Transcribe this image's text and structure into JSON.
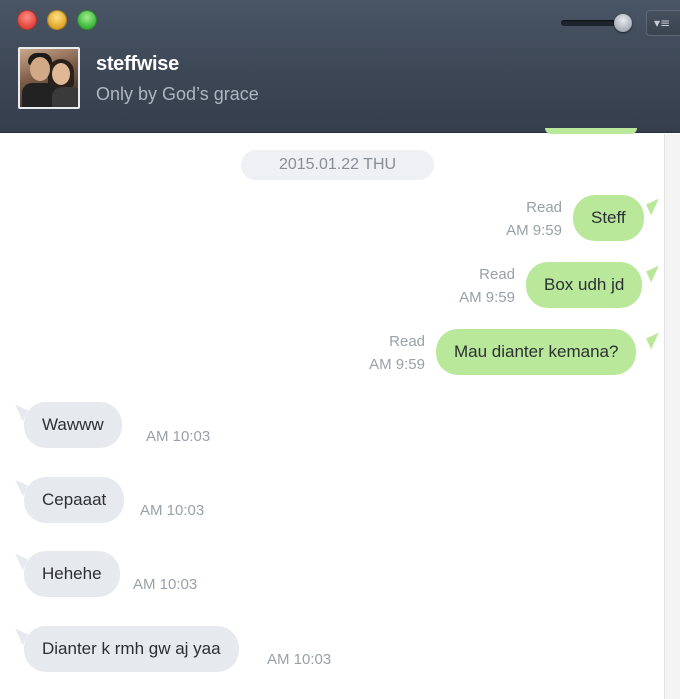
{
  "window": {
    "controls": [
      "close",
      "minimize",
      "maximize"
    ],
    "menu_button_glyph": "▾≡"
  },
  "header": {
    "contact_name": "steffwise",
    "contact_status": "Only by God’s grace"
  },
  "chat": {
    "date_separator": "2015.01.22 THU",
    "messages": [
      {
        "direction": "outgoing",
        "text": "Steff",
        "read": "Read",
        "time": "AM 9:59"
      },
      {
        "direction": "outgoing",
        "text": "Box udh jd",
        "read": "Read",
        "time": "AM 9:59"
      },
      {
        "direction": "outgoing",
        "text": "Mau dianter kemana?",
        "read": "Read",
        "time": "AM 9:59"
      },
      {
        "direction": "incoming",
        "text": "Wawww",
        "time": "AM 10:03"
      },
      {
        "direction": "incoming",
        "text": "Cepaaat",
        "time": "AM 10:03"
      },
      {
        "direction": "incoming",
        "text": "Hehehe",
        "time": "AM 10:03"
      },
      {
        "direction": "incoming",
        "text": "Dianter k rmh gw aj yaa",
        "time": "AM 10:03"
      }
    ]
  },
  "colors": {
    "header_bg": "#3d4756",
    "outgoing_bubble": "#b9e89a",
    "incoming_bubble": "#e6e9ee",
    "meta_text": "#9aa0a8"
  },
  "icons": [
    "close-icon",
    "minimize-icon",
    "maximize-icon",
    "menu-icon"
  ]
}
